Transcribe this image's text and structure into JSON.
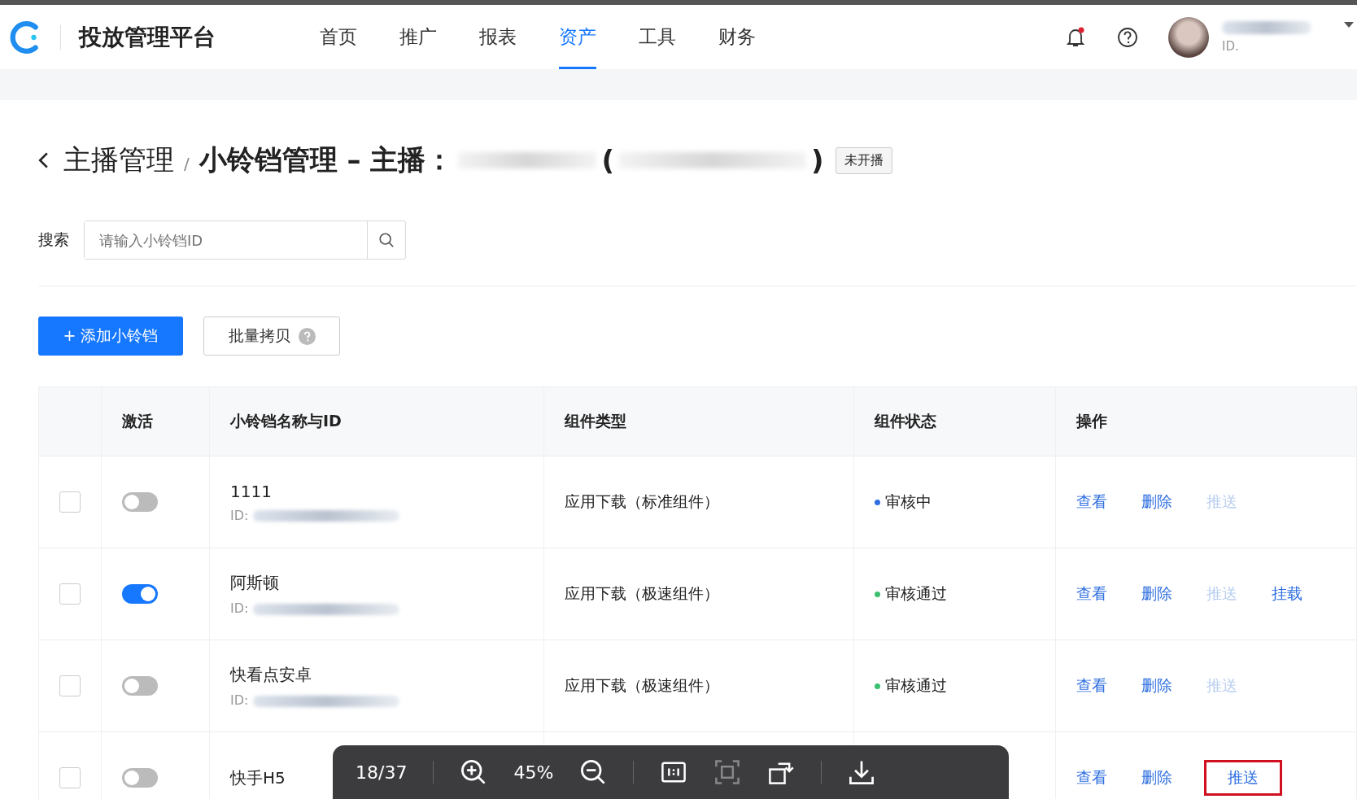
{
  "brand": {
    "title": "投放管理平台"
  },
  "nav": [
    {
      "label": "首页",
      "selected": false
    },
    {
      "label": "推广",
      "selected": false
    },
    {
      "label": "报表",
      "selected": false
    },
    {
      "label": "资产",
      "selected": true
    },
    {
      "label": "工具",
      "selected": false
    },
    {
      "label": "财务",
      "selected": false
    }
  ],
  "user": {
    "id_label": "ID.",
    "has_notification": true
  },
  "breadcrumb": {
    "parent": "主播管理",
    "separator": "/",
    "current": "小铃铛管理 – 主播：",
    "paren_open": "(",
    "paren_close": ")",
    "status_tag": "未开播"
  },
  "search": {
    "label": "搜索",
    "placeholder": "请输入小铃铛ID"
  },
  "actions": {
    "add": "+ 添加小铃铛",
    "batch": "批量拷贝"
  },
  "table": {
    "columns": [
      "激活",
      "小铃铛名称与ID",
      "组件类型",
      "组件状态",
      "操作"
    ],
    "rows": [
      {
        "checked": false,
        "on": false,
        "name": "1111",
        "id_label": "ID:",
        "type": "应用下载（标准组件）",
        "status": "审核中",
        "color": "#2f6fe0",
        "ops": [
          {
            "label": "查看",
            "disabled": false,
            "highlighted": false
          },
          {
            "label": "删除",
            "disabled": false,
            "highlighted": false
          },
          {
            "label": "推送",
            "disabled": true,
            "highlighted": false
          }
        ]
      },
      {
        "checked": false,
        "on": true,
        "name": "阿斯顿",
        "id_label": "ID:",
        "type": "应用下载（极速组件）",
        "status": "审核通过",
        "color": "#3cc070",
        "ops": [
          {
            "label": "查看",
            "disabled": false,
            "highlighted": false
          },
          {
            "label": "删除",
            "disabled": false,
            "highlighted": false
          },
          {
            "label": "推送",
            "disabled": true,
            "highlighted": false
          },
          {
            "label": "挂载",
            "disabled": false,
            "highlighted": false
          }
        ]
      },
      {
        "checked": false,
        "on": false,
        "name": "快看点安卓",
        "id_label": "ID:",
        "type": "应用下载（极速组件）",
        "status": "审核通过",
        "color": "#3cc070",
        "ops": [
          {
            "label": "查看",
            "disabled": false,
            "highlighted": false
          },
          {
            "label": "删除",
            "disabled": false,
            "highlighted": false
          },
          {
            "label": "推送",
            "disabled": true,
            "highlighted": false
          }
        ]
      },
      {
        "checked": false,
        "on": false,
        "name": "快手H5",
        "ops": [
          {
            "label": "查看",
            "disabled": false,
            "highlighted": false
          },
          {
            "label": "删除",
            "disabled": false,
            "highlighted": false
          },
          {
            "label": "推送",
            "disabled": false,
            "highlighted": true
          }
        ]
      }
    ]
  },
  "viewer": {
    "page": "18/37",
    "zoom": "45%"
  }
}
